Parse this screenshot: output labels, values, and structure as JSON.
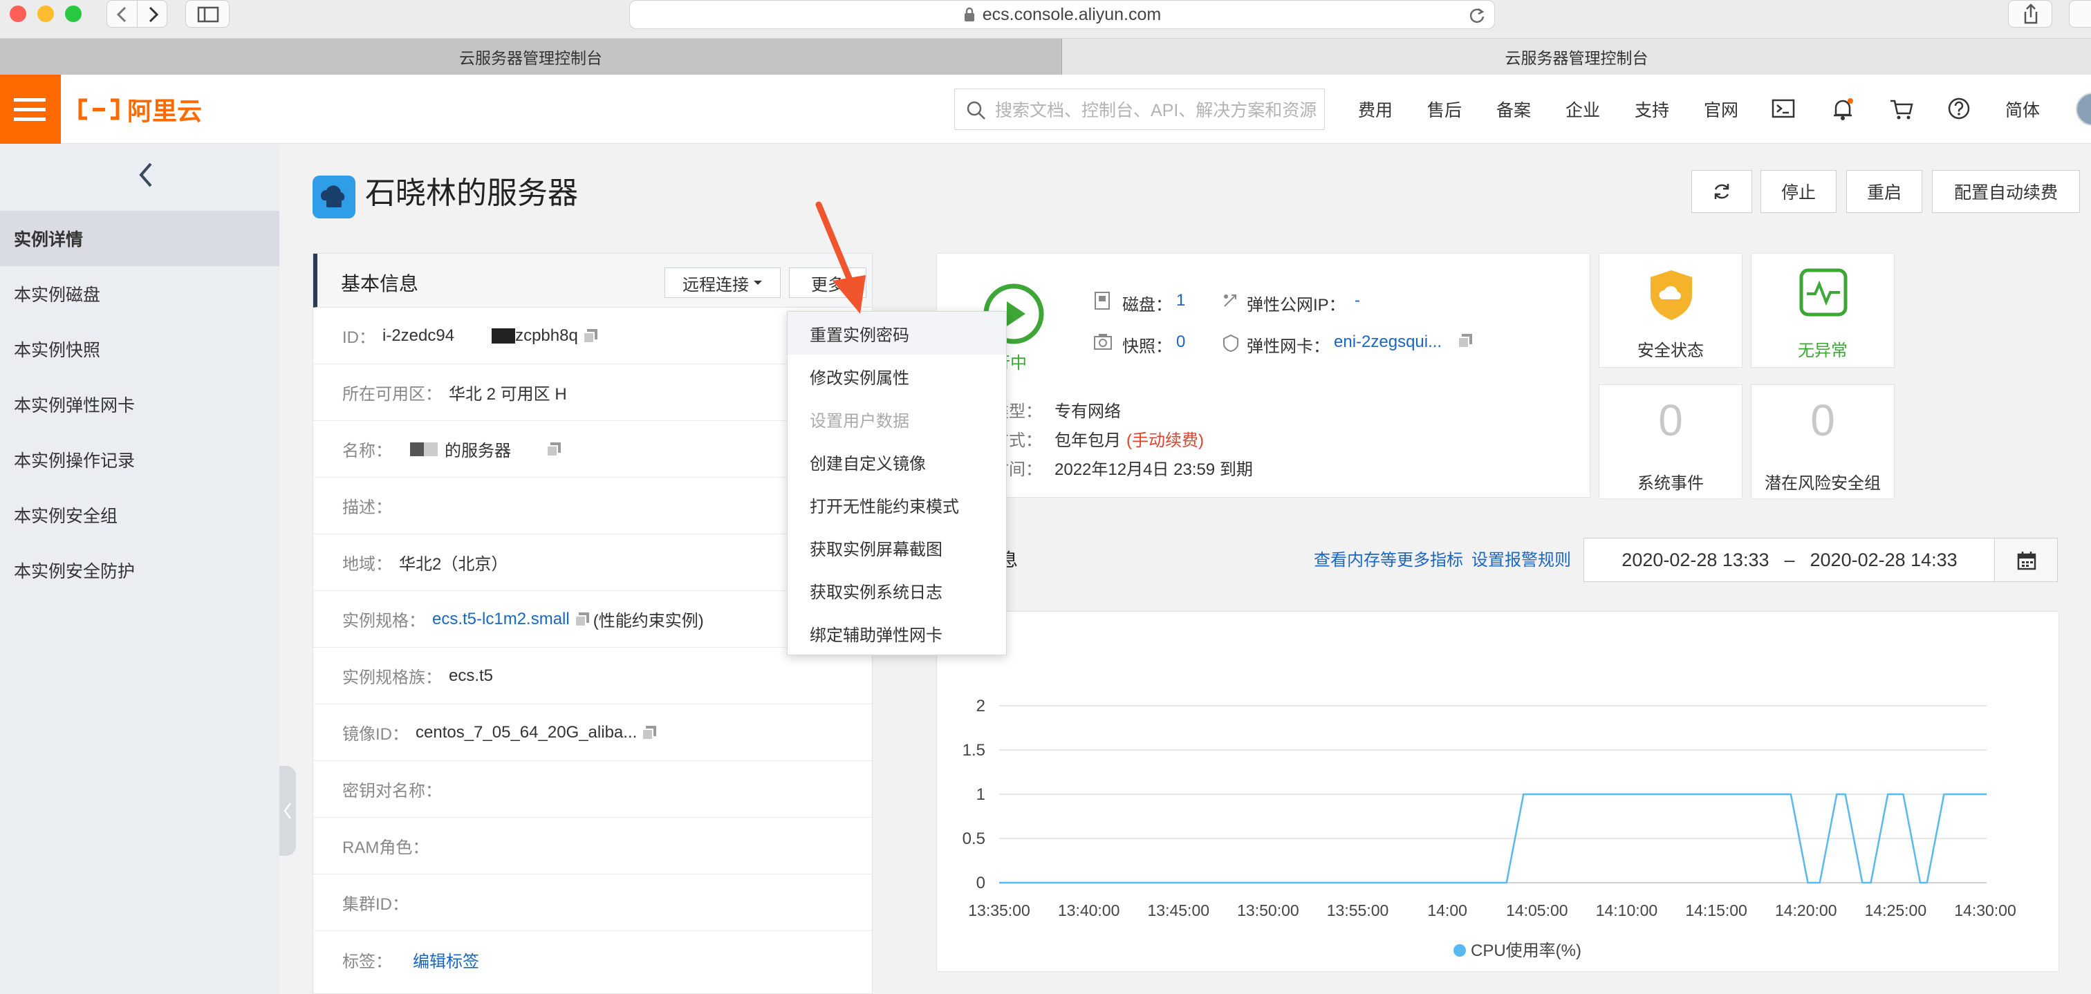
{
  "browser": {
    "url": "ecs.console.aliyun.com",
    "tabs": [
      {
        "label": "云服务器管理控制台"
      },
      {
        "label": "云服务器管理控制台"
      }
    ]
  },
  "header": {
    "logo_text": "阿里云",
    "search_placeholder": "搜索文档、控制台、API、解决方案和资源",
    "links": [
      "费用",
      "售后",
      "备案",
      "企业",
      "支持",
      "官网"
    ],
    "lang": "简体"
  },
  "sidebar": {
    "items": [
      {
        "label": "实例详情",
        "active": true
      },
      {
        "label": "本实例磁盘"
      },
      {
        "label": "本实例快照"
      },
      {
        "label": "本实例弹性网卡"
      },
      {
        "label": "本实例操作记录"
      },
      {
        "label": "本实例安全组"
      },
      {
        "label": "本实例安全防护"
      }
    ]
  },
  "page": {
    "title": "石晓林的服务器",
    "buttons": {
      "stop": "停止",
      "restart": "重启",
      "auto_renew": "配置自动续费"
    }
  },
  "info": {
    "title": "基本信息",
    "remote_btn": "远程连接",
    "more_btn": "更多",
    "rows": [
      {
        "label": "ID：",
        "value_a": "i-2zedc94",
        "value_b": "zcpbh8q"
      },
      {
        "label": "所在可用区：",
        "value": "华北 2 可用区 H"
      },
      {
        "label": "名称：",
        "value": "的服务器"
      },
      {
        "label": "描述：",
        "value": ""
      },
      {
        "label": "地域：",
        "value": "华北2（北京）"
      },
      {
        "label": "实例规格：",
        "link": "ecs.t5-lc1m2.small",
        "suffix": "(性能约束实例)"
      },
      {
        "label": "实例规格族：",
        "value": "ecs.t5"
      },
      {
        "label": "镜像ID：",
        "value": "centos_7_05_64_20G_aliba..."
      },
      {
        "label": "密钥对名称：",
        "value": ""
      },
      {
        "label": "RAM角色：",
        "value": ""
      },
      {
        "label": "集群ID：",
        "value": ""
      },
      {
        "label": "标签：",
        "link": "编辑标签"
      }
    ]
  },
  "more_menu": {
    "items": [
      {
        "label": "重置实例密码",
        "hover": true
      },
      {
        "label": "修改实例属性"
      },
      {
        "label": "设置用户数据",
        "disabled": true
      },
      {
        "label": "创建自定义镜像"
      },
      {
        "label": "打开无性能约束模式"
      },
      {
        "label": "获取实例屏幕截图"
      },
      {
        "label": "获取实例系统日志"
      },
      {
        "label": "绑定辅助弹性网卡"
      }
    ]
  },
  "status": {
    "run_state": "行中",
    "disk_label": "磁盘：",
    "disk_value": "1",
    "snapshot_label": "快照：",
    "snapshot_value": "0",
    "eip_label": "弹性公网IP：",
    "eip_value": "-",
    "eni_label": "弹性网卡：",
    "eni_value": "eni-2zegsqui...",
    "network_label": "类型：",
    "network_value": "专有网络",
    "billing_label": "方式：",
    "billing_value": "包年包月",
    "billing_note": "(手动续费)",
    "expire_label": "时间：",
    "expire_value": "2022年12月4日 23:59 到期"
  },
  "tiles": {
    "security": "安全状态",
    "health": "无异常",
    "events_count": "0",
    "events_label": "系统事件",
    "risk_count": "0",
    "risk_label": "潜在风险安全组"
  },
  "monitor": {
    "title_fragment": "息",
    "more_metrics": "查看内存等更多指标",
    "alarm_rules": "设置报警规则",
    "date_from": "2020-02-28 13:33",
    "date_sep": "–",
    "date_to": "2020-02-28 14:33"
  },
  "colors": {
    "brand": "#ff6a00",
    "link": "#1a66c2",
    "run_green": "#3da636",
    "cpu_line": "#58b8f0",
    "warning_red": "#e0412b"
  },
  "chart_data": {
    "type": "line",
    "x_ticks": [
      "13:35:00",
      "13:40:00",
      "13:45:00",
      "13:50:00",
      "13:55:00",
      "14:00",
      "14:05:00",
      "14:10:00",
      "14:15:00",
      "14:20:00",
      "14:25:00",
      "14:30:00"
    ],
    "y_ticks": [
      "0",
      "0.5",
      "1",
      "1.5",
      "2"
    ],
    "ylim": [
      0,
      2
    ],
    "xlim": [
      0,
      58
    ],
    "series": [
      {
        "name": "CPU使用率(%)",
        "points": [
          [
            0,
            0
          ],
          [
            29.8,
            0
          ],
          [
            30.8,
            1
          ],
          [
            46.5,
            1
          ],
          [
            47.5,
            0
          ],
          [
            48.2,
            0
          ],
          [
            49.2,
            1
          ],
          [
            49.7,
            1
          ],
          [
            50.7,
            0
          ],
          [
            51.2,
            0
          ],
          [
            52.2,
            1
          ],
          [
            53.1,
            1
          ],
          [
            54.1,
            0
          ],
          [
            54.5,
            0
          ],
          [
            55.5,
            1
          ],
          [
            57.5,
            1
          ],
          [
            58,
            1
          ]
        ]
      }
    ]
  }
}
